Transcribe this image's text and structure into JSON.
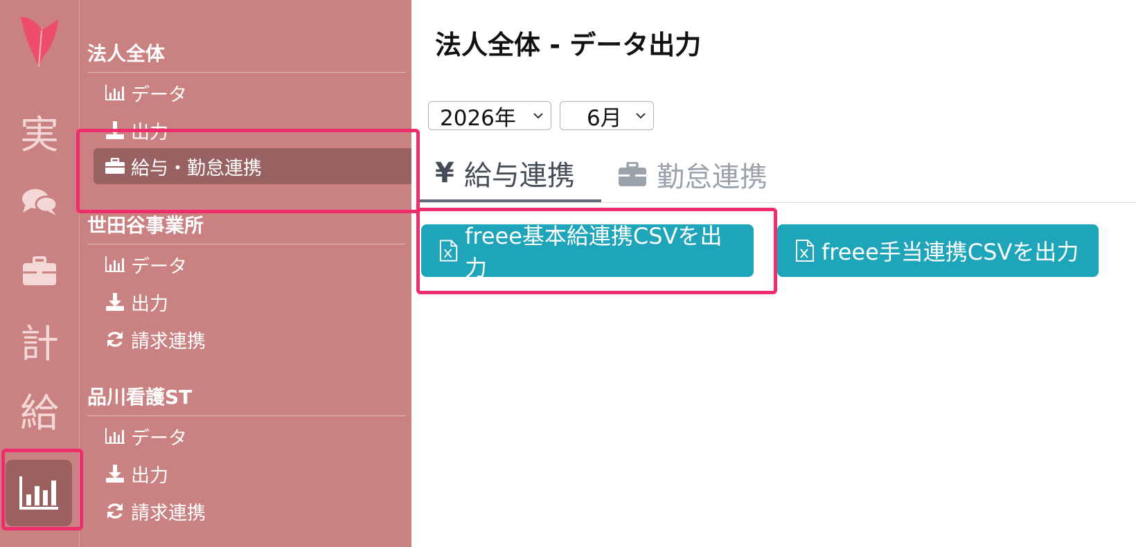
{
  "rail": {
    "items": [
      {
        "label": "実"
      },
      {
        "icon": "chat-icon"
      },
      {
        "icon": "briefcase-icon"
      },
      {
        "label": "計"
      },
      {
        "label": "給"
      },
      {
        "icon": "bar-chart-icon",
        "active": true
      }
    ]
  },
  "sidebar": {
    "groups": [
      {
        "title": "法人全体",
        "items": [
          {
            "icon": "bar-chart-icon",
            "label": "データ"
          },
          {
            "icon": "download-icon",
            "label": "出力"
          },
          {
            "icon": "briefcase-icon",
            "label": "給与・勤怠連携",
            "active": true
          }
        ]
      },
      {
        "title": "世田谷事業所",
        "items": [
          {
            "icon": "bar-chart-icon",
            "label": "データ"
          },
          {
            "icon": "download-icon",
            "label": "出力"
          },
          {
            "icon": "refresh-icon",
            "label": "請求連携"
          }
        ]
      },
      {
        "title": "品川看護ST",
        "items": [
          {
            "icon": "bar-chart-icon",
            "label": "データ"
          },
          {
            "icon": "download-icon",
            "label": "出力"
          },
          {
            "icon": "refresh-icon",
            "label": "請求連携"
          }
        ]
      }
    ]
  },
  "main": {
    "title": "法人全体 - データ出力",
    "year_select": "2026年",
    "month_select": "6月",
    "tabs": [
      {
        "icon": "yen-icon",
        "icon_text": "¥",
        "label": "給与連携",
        "active": true
      },
      {
        "icon": "briefcase-icon",
        "label": "勤怠連携",
        "active": false
      }
    ],
    "buttons": [
      {
        "icon": "csv-file-icon",
        "label": "freee基本給連携CSVを出力"
      },
      {
        "icon": "csv-file-icon",
        "label": "freee手当連携CSVを出力"
      }
    ]
  },
  "colors": {
    "sidebar_bg": "#c98181",
    "sidebar_active": "#986262",
    "button_teal": "#1fa5b9",
    "highlight": "#ee2d6a"
  }
}
